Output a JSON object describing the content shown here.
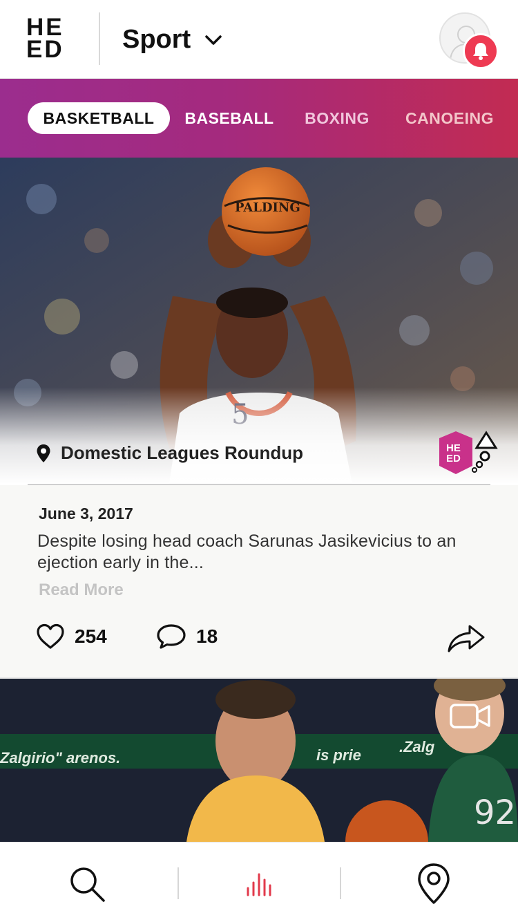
{
  "header": {
    "logo_line1": "HE",
    "logo_line2": "ED",
    "section_title": "Sport",
    "chevron_icon": "chevron-down-icon",
    "avatar_icon": "user-avatar-icon",
    "notification_icon": "bell-icon",
    "notification_color": "#ee3a52"
  },
  "tabs": [
    {
      "label": "BASKETBALL",
      "active": true
    },
    {
      "label": "BASEBALL",
      "active": false
    },
    {
      "label": "BOXING",
      "active": false
    },
    {
      "label": "CANOEING",
      "active": false
    }
  ],
  "tabs_gradient": [
    "#9b2d8e",
    "#c22b52"
  ],
  "card1": {
    "image": "basketball-player-shooting-photo",
    "ball_text": "PALDING",
    "jersey_number": "5",
    "location_icon": "map-pin-icon",
    "location": "Domestic Leagues Roundup",
    "badge_icon": "heed-hexagon-badge-icon",
    "badge_line1": "HE",
    "badge_line2": "ED",
    "date": "June 3, 2017",
    "excerpt": "Despite losing head coach Sarunas Jasikevicius to an ejection early in the...",
    "read_more": "Read More",
    "likes": "254",
    "comments": "18",
    "like_icon": "heart-icon",
    "comment_icon": "speech-bubble-icon",
    "share_icon": "share-arrow-icon"
  },
  "card2": {
    "image": "basketball-players-game-photo",
    "banner_text_left": "Zalgirio\" arenos.",
    "banner_text_mid": "is prie",
    "banner_text_right": ".Zalg",
    "jersey_number": "92",
    "video_icon": "video-camera-icon"
  },
  "bottom_nav": [
    {
      "name": "search",
      "icon": "search-icon"
    },
    {
      "name": "feed",
      "icon": "audio-bars-icon",
      "active": true,
      "color": "#e23a4b"
    },
    {
      "name": "map",
      "icon": "location-pin-icon"
    }
  ]
}
